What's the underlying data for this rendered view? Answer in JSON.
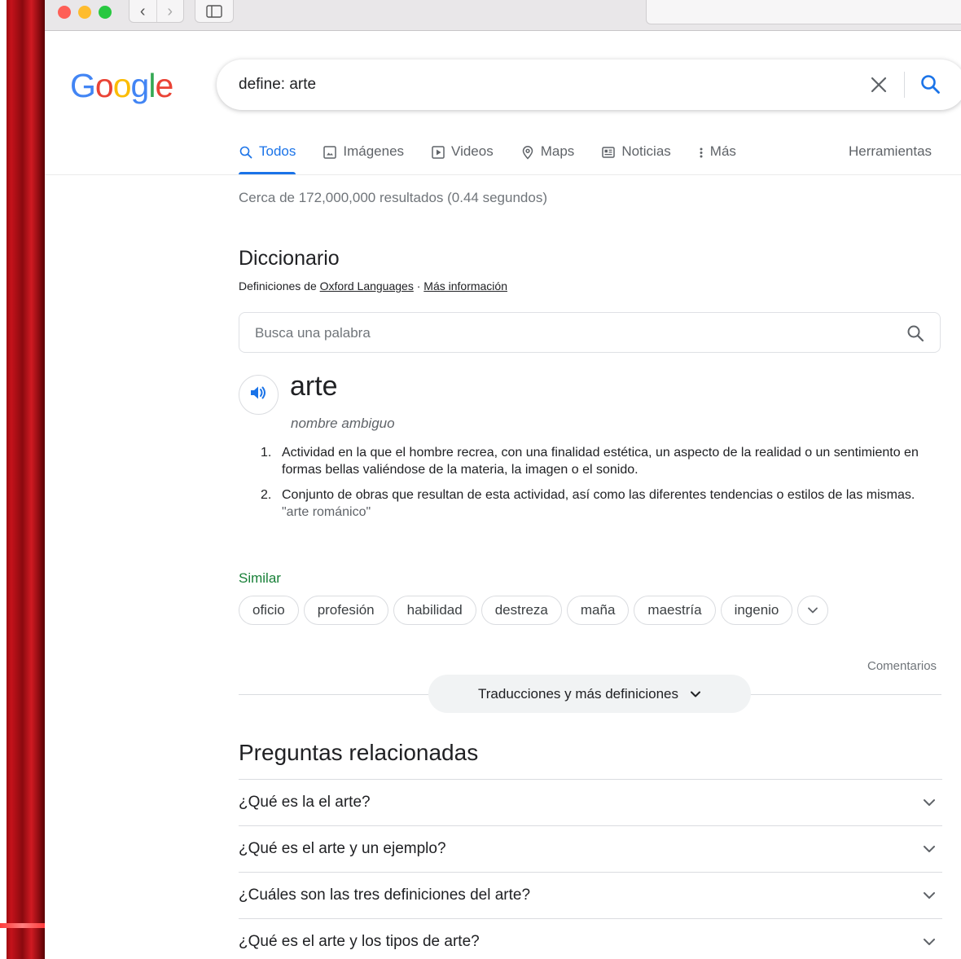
{
  "search": {
    "query": "define: arte"
  },
  "tabs": [
    {
      "label": "Todos"
    },
    {
      "label": "Imágenes"
    },
    {
      "label": "Videos"
    },
    {
      "label": "Maps"
    },
    {
      "label": "Noticias"
    },
    {
      "label": "Más"
    }
  ],
  "tools_label": "Herramientas",
  "stats": "Cerca de 172,000,000 resultados (0.44 segundos)",
  "dictionary": {
    "title": "Diccionario",
    "source_prefix": "Definiciones de",
    "source_link": "Oxford Languages",
    "separator": "·",
    "more_info": "Más información",
    "search_placeholder": "Busca una palabra",
    "word": "arte",
    "part_of_speech": "nombre ambiguo",
    "definitions": [
      {
        "num": "1.",
        "text": "Actividad en la que el hombre recrea, con una finalidad estética, un aspecto de la realidad o un sentimiento en formas bellas valiéndose de la materia, la imagen o el sonido.",
        "example": ""
      },
      {
        "num": "2.",
        "text": "Conjunto de obras que resultan de esta actividad, así como las diferentes tendencias o estilos de las mismas.",
        "example": "\"arte románico\""
      }
    ],
    "similar_label": "Similar",
    "similar": [
      "oficio",
      "profesión",
      "habilidad",
      "destreza",
      "maña",
      "maestría",
      "ingenio"
    ]
  },
  "feedback": "Comentarios",
  "more_definitions": "Traducciones y más definiciones",
  "related": {
    "title": "Preguntas relacionadas",
    "questions": [
      "¿Qué es la el arte?",
      "¿Qué es el arte y un ejemplo?",
      "¿Cuáles son las tres definiciones del arte?",
      "¿Qué es el arte y los tipos de arte?"
    ]
  },
  "colors": {
    "accent": "#1a73e8",
    "similar": "#188038",
    "logo_blue": "#4285f4",
    "logo_red": "#ea4335",
    "logo_yellow": "#fbbc05",
    "logo_green": "#34a853"
  }
}
